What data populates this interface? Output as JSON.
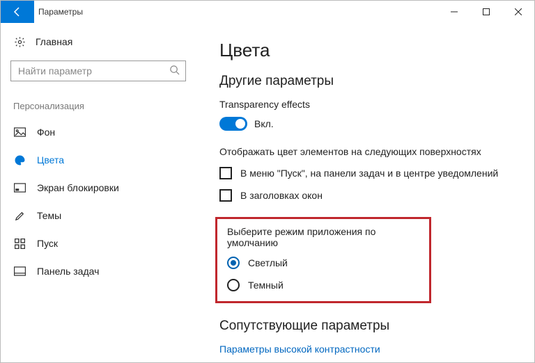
{
  "titlebar": {
    "title": "Параметры"
  },
  "sidebar": {
    "home": "Главная",
    "search_placeholder": "Найти параметр",
    "section": "Персонализация",
    "items": [
      {
        "label": "Фон"
      },
      {
        "label": "Цвета"
      },
      {
        "label": "Экран блокировки"
      },
      {
        "label": "Темы"
      },
      {
        "label": "Пуск"
      },
      {
        "label": "Панель задач"
      }
    ]
  },
  "main": {
    "title": "Цвета",
    "subheading": "Другие параметры",
    "transparency": {
      "label": "Transparency effects",
      "state": "Вкл."
    },
    "surfaces": {
      "label": "Отображать цвет элементов на следующих поверхностях",
      "options": [
        "В меню \"Пуск\", на панели задач и в центре уведомлений",
        "В заголовках окон"
      ]
    },
    "appmode": {
      "label": "Выберите режим приложения по умолчанию",
      "options": [
        "Светлый",
        "Темный"
      ]
    },
    "related": {
      "heading": "Сопутствующие параметры",
      "link": "Параметры высокой контрастности"
    }
  }
}
